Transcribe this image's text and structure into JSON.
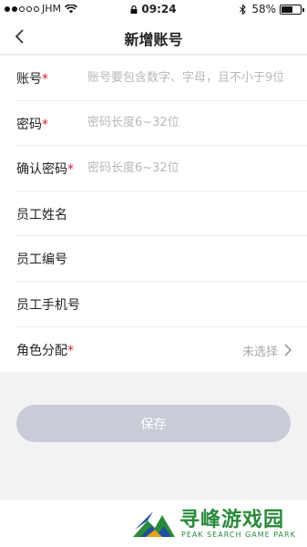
{
  "status_bar": {
    "carrier": "JHM",
    "time": "09:24",
    "battery": "58%",
    "battery_level": 0.58
  },
  "nav": {
    "title": "新增账号",
    "back_icon": "chevron-left-icon"
  },
  "form": {
    "fields": [
      {
        "label": "账号",
        "required": "*",
        "placeholder": "账号要包含数字、字母，且不小于9位",
        "value": ""
      },
      {
        "label": "密码",
        "required": "*",
        "placeholder": "密码长度6~32位",
        "value": ""
      },
      {
        "label": "确认密码",
        "required": "*",
        "placeholder": "密码长度6~32位",
        "value": ""
      },
      {
        "label": "员工姓名",
        "required": "",
        "placeholder": "",
        "value": ""
      },
      {
        "label": "员工编号",
        "required": "",
        "placeholder": "",
        "value": ""
      },
      {
        "label": "员工手机号",
        "required": "",
        "placeholder": "",
        "value": ""
      }
    ],
    "role": {
      "label": "角色分配",
      "required": "*",
      "value": "未选择"
    }
  },
  "save_button": "保存",
  "footer": {
    "brand_name": "寻峰游戏园",
    "brand_sub": "PEAK SEARCH GAME PARK",
    "brand_color": "#2a8a3c"
  }
}
